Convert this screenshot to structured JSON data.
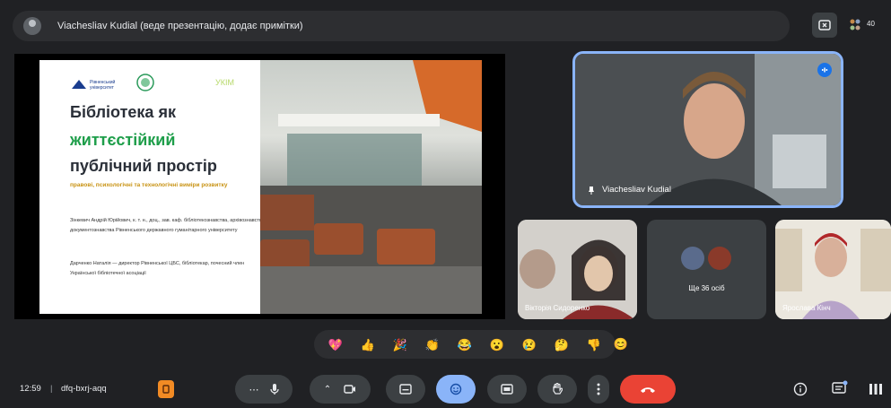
{
  "presenter_bar": {
    "title": "Viachesliav Kudial (веде презентацію, додає примітки)"
  },
  "top_right": {
    "badge": "40"
  },
  "slide": {
    "logo_text": "Рівненський університет",
    "logo3_text": "УКІМ",
    "title_line1": "Бібліотека як",
    "title_line2": "життєстійкий",
    "title_line3": "публічний простір",
    "subtitle": "правові, психологічні та технологічні виміри розвитку",
    "speaker1": "Зінкевич Андрій Юрійович, к. т. н., доц., зав. каф. бібліотекознавства, архівознавства і документознавства Рівненського державного гуманітарного університету",
    "speaker2": "Дарченко Наталія — директор Рівненської ЦБС, бібліотекар, почесний член Української бібліотечної асоціації"
  },
  "tiles": {
    "speaker_name": "Viachesliav Kudial",
    "tile2_name": "Вікторія Сидоренко",
    "tile3_name": "Ще 36 осіб",
    "tile4_name": "Ярослава Кінч"
  },
  "reactions": [
    "💖",
    "👍",
    "🎉",
    "👏",
    "😂",
    "😮",
    "😢",
    "🤔",
    "👎"
  ],
  "reaction_toggle": "😊",
  "bottom": {
    "time": "12:59",
    "separator": "|",
    "meeting_code": "dfq-bxrj-aqq"
  },
  "colors": {
    "accent_blue": "#8ab4f8",
    "end_call_red": "#ea4335",
    "dark_bg": "#202124"
  }
}
